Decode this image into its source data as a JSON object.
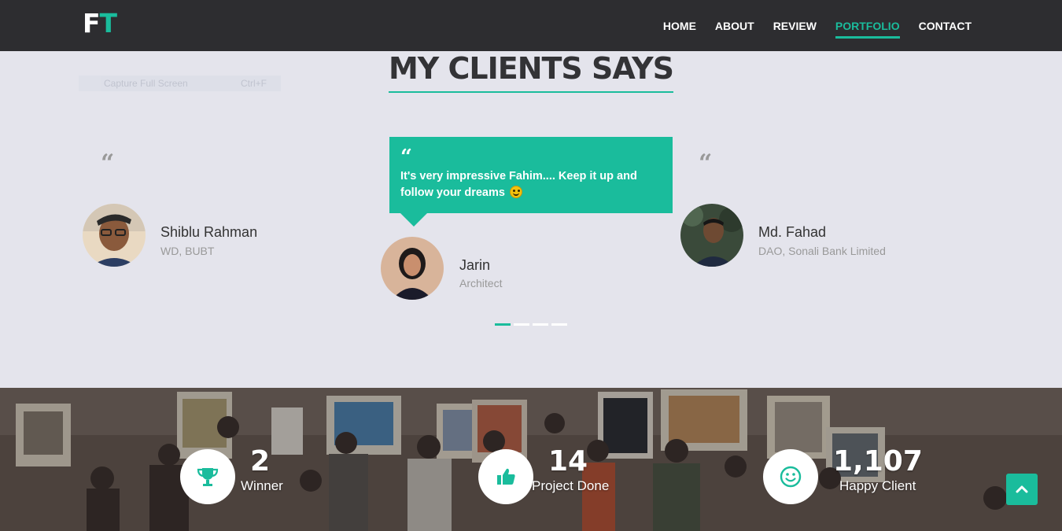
{
  "brand": {
    "letter1": "F",
    "letter2": "T"
  },
  "nav": {
    "items": [
      {
        "label": "HOME"
      },
      {
        "label": "ABOUT"
      },
      {
        "label": "REVIEW"
      },
      {
        "label": "PORTFOLIO",
        "active": true
      },
      {
        "label": "CONTACT"
      }
    ]
  },
  "ghost_tooltip": {
    "label": "Capture Full Screen",
    "shortcut": "Ctrl+F"
  },
  "section": {
    "title": "MY CLIENTS SAYS"
  },
  "testimonials": [
    {
      "name": "Shiblu Rahman",
      "role": "WD, BUBT",
      "quote_icon": "quote-left-icon"
    },
    {
      "name": "Jarin",
      "role": "Architect",
      "quote": "It's very impressive Fahim.... Keep it up and follow your dreams",
      "quote_icon": "quote-left-icon"
    },
    {
      "name": "Md. Fahad",
      "role": "DAO, Sonali Bank Limited",
      "quote_icon": "quote-left-icon"
    }
  ],
  "carousel": {
    "pages": 4,
    "active_page": 1
  },
  "counters": [
    {
      "value": "2",
      "label": "Winner",
      "icon": "trophy-icon"
    },
    {
      "value": "14",
      "label": "Project Done",
      "icon": "thumbs-up-icon"
    },
    {
      "value": "1,107",
      "label": "Happy Client",
      "icon": "smile-icon"
    }
  ],
  "colors": {
    "accent": "#1abc9c",
    "navbar": "#2d2d30",
    "section_bg": "#e4e4ec"
  },
  "back_to_top": {
    "icon": "chevron-up-icon"
  }
}
